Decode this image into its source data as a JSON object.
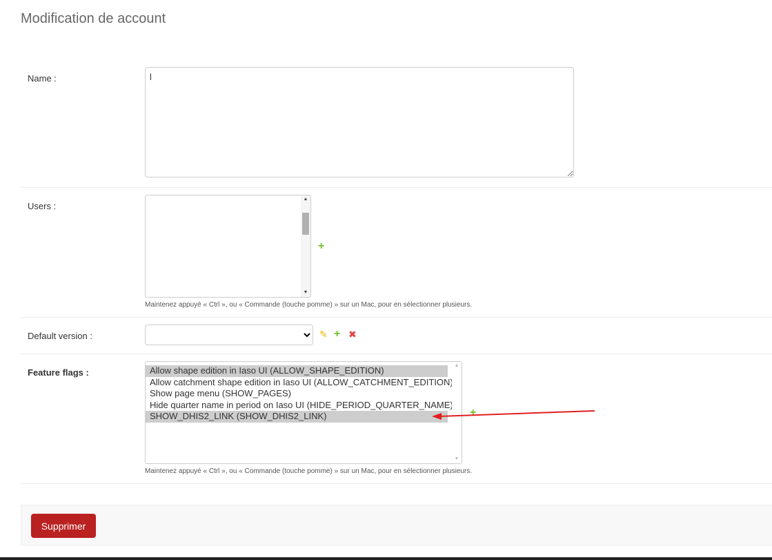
{
  "page": {
    "title": "Modification de account"
  },
  "fields": {
    "name": {
      "label": "Name :",
      "value": "l"
    },
    "users": {
      "label": "Users :",
      "help": "Maintenez appuyé « Ctrl », ou « Commande (touche pomme) » sur un Mac, pour en sélectionner plusieurs.",
      "add_icon": "plus-icon"
    },
    "default_version": {
      "label": "Default version :",
      "selected": "",
      "icons": [
        "pencil-icon",
        "plus-icon",
        "x-icon"
      ]
    },
    "feature_flags": {
      "label": "Feature flags :",
      "options": [
        {
          "label": "Allow shape edition in Iaso UI (ALLOW_SHAPE_EDITION)",
          "selected": true
        },
        {
          "label": "Allow catchment shape edition in Iaso UI (ALLOW_CATCHMENT_EDITION)",
          "selected": false
        },
        {
          "label": "Show page menu (SHOW_PAGES)",
          "selected": false
        },
        {
          "label": "Hide quarter name in period on Iaso UI (HIDE_PERIOD_QUARTER_NAME)",
          "selected": false
        },
        {
          "label": "SHOW_DHIS2_LINK (SHOW_DHIS2_LINK)",
          "selected": true
        }
      ],
      "help": "Maintenez appuyé « Ctrl », ou « Commande (touche pomme) » sur un Mac, pour en sélectionner plusieurs.",
      "add_icon": "plus-icon"
    }
  },
  "actions": {
    "delete_label": "Supprimer"
  },
  "colors": {
    "delete_button": "#ba2121",
    "add_icon": "#70bf2b",
    "annotation_arrow": "#e02020"
  }
}
